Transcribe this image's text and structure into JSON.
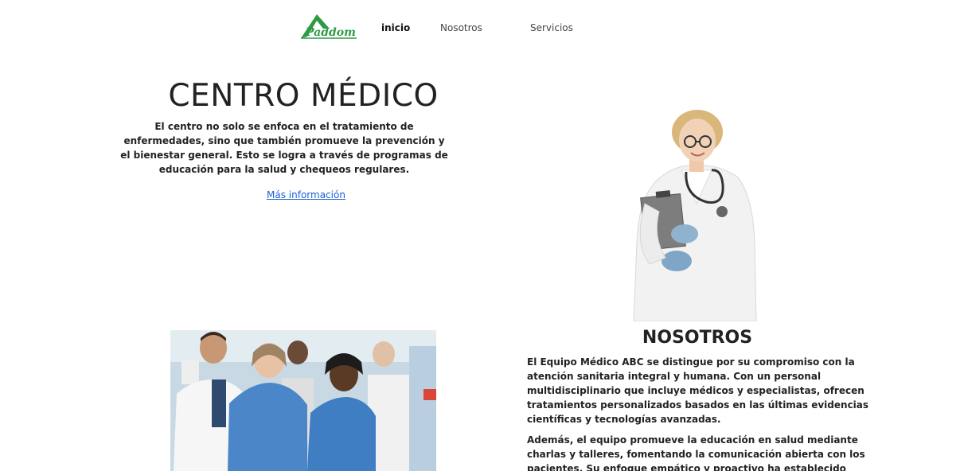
{
  "nav": {
    "logo_text": "Paddom",
    "items": [
      "inicio",
      "Nosotros",
      "Servicios"
    ]
  },
  "hero": {
    "title": "CENTRO MÉDICO",
    "description": "El centro no solo se enfoca en el tratamiento de enfermedades, sino que también promueve la prevención y el bienestar general. Esto se logra a través de programas de educación para la salud y chequeos regulares.",
    "link": "Más información"
  },
  "about": {
    "title": "NOSOTROS",
    "paragraph1": "El Equipo Médico ABC se distingue por su compromiso con la atención sanitaria integral y humana. Con un personal multidisciplinario que incluye médicos y especialistas, ofrecen tratamientos personalizados basados en las últimas evidencias científicas y tecnologías avanzadas.",
    "paragraph2": "Además, el equipo promueve la educación en salud mediante charlas y talleres, fomentando la comunicación abierta con los pacientes. Su enfoque empático y proactivo ha establecido relaciones de confianza,"
  },
  "colors": {
    "logo_green": "#2e9a45",
    "link_blue": "#1a5fd6",
    "scrubs_blue": "#4a86c8"
  }
}
